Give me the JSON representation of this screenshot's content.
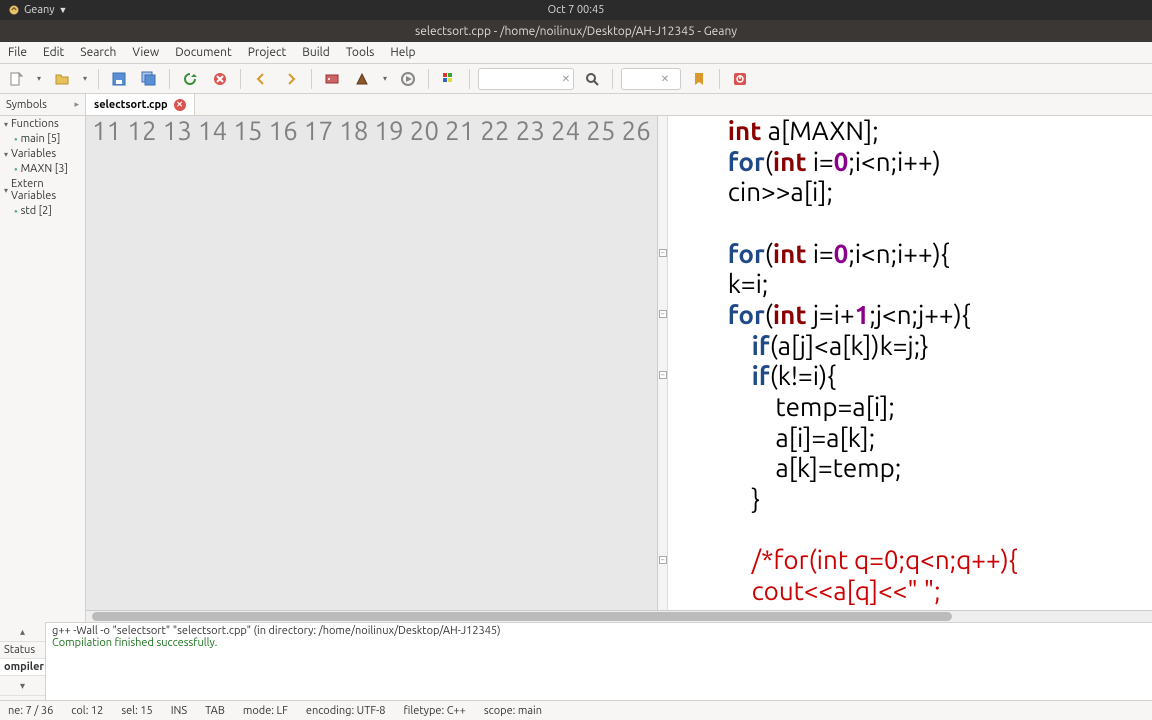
{
  "os": {
    "appname": "Geany",
    "clock": "Oct 7  00:45"
  },
  "title": "selectsort.cpp - /home/noilinux/Desktop/AH-J12345 - Geany",
  "menu": [
    "File",
    "Edit",
    "Search",
    "View",
    "Document",
    "Project",
    "Build",
    "Tools",
    "Help"
  ],
  "sidetab": {
    "label": "Symbols"
  },
  "filetab": {
    "name": "selectsort.cpp"
  },
  "symbols": {
    "groups": [
      {
        "label": "Functions",
        "items": [
          "main [5]"
        ]
      },
      {
        "label": "Variables",
        "items": [
          "MAXN [3]"
        ]
      },
      {
        "label": "Extern Variables",
        "items": [
          "std [2]"
        ]
      }
    ]
  },
  "code": {
    "first_line": 11,
    "lines": [
      {
        "n": 11,
        "tokens": [
          {
            "t": "int ",
            "c": "ty"
          },
          {
            "t": "a[MAXN];"
          }
        ]
      },
      {
        "n": 12,
        "tokens": [
          {
            "t": "for",
            "c": "kw"
          },
          {
            "t": "("
          },
          {
            "t": "int ",
            "c": "ty"
          },
          {
            "t": "i="
          },
          {
            "t": "0",
            "c": "num"
          },
          {
            "t": ";i<n;i++)"
          }
        ]
      },
      {
        "n": 13,
        "tokens": [
          {
            "t": "cin>>a[i];"
          }
        ]
      },
      {
        "n": 14,
        "tokens": [
          {
            "t": ""
          }
        ]
      },
      {
        "n": 15,
        "fold": true,
        "tokens": [
          {
            "t": "for",
            "c": "kw"
          },
          {
            "t": "("
          },
          {
            "t": "int ",
            "c": "ty"
          },
          {
            "t": "i="
          },
          {
            "t": "0",
            "c": "num"
          },
          {
            "t": ";i<n;i++){"
          }
        ]
      },
      {
        "n": 16,
        "tokens": [
          {
            "t": "k=i;"
          }
        ]
      },
      {
        "n": 17,
        "fold": true,
        "tokens": [
          {
            "t": "for",
            "c": "kw"
          },
          {
            "t": "("
          },
          {
            "t": "int ",
            "c": "ty"
          },
          {
            "t": "j=i+"
          },
          {
            "t": "1",
            "c": "num"
          },
          {
            "t": ";j<n;j++){"
          }
        ]
      },
      {
        "n": 18,
        "tokens": [
          {
            "t": "    "
          },
          {
            "t": "if",
            "c": "kw"
          },
          {
            "t": "(a[j]<a[k])k=j;}"
          }
        ]
      },
      {
        "n": 19,
        "fold": true,
        "tokens": [
          {
            "t": "    "
          },
          {
            "t": "if",
            "c": "kw"
          },
          {
            "t": "(k!=i){"
          }
        ]
      },
      {
        "n": 20,
        "tokens": [
          {
            "t": "        temp=a[i];"
          }
        ]
      },
      {
        "n": 21,
        "tokens": [
          {
            "t": "        a[i]=a[k];"
          }
        ]
      },
      {
        "n": 22,
        "tokens": [
          {
            "t": "        a[k]=temp;"
          }
        ]
      },
      {
        "n": 23,
        "tokens": [
          {
            "t": "    }"
          }
        ]
      },
      {
        "n": 24,
        "tokens": [
          {
            "t": ""
          }
        ]
      },
      {
        "n": 25,
        "fold": true,
        "tokens": [
          {
            "t": "    "
          },
          {
            "t": "/*for(int q=0;q<n;q++){",
            "c": "cm"
          }
        ]
      },
      {
        "n": 26,
        "tokens": [
          {
            "t": "    "
          },
          {
            "t": "cout<<a[q]<<\" \";",
            "c": "cm"
          }
        ]
      }
    ]
  },
  "messages": {
    "line1": "g++ -Wall -o \"selectsort\" \"selectsort.cpp\" (in directory: /home/noilinux/Desktop/AH-J12345)",
    "line2": "Compilation finished successfully."
  },
  "bottomtabs": {
    "status": "Status",
    "compiler": "ompiler"
  },
  "status": {
    "pos": "ne: 7 / 36",
    "col": "col: 12",
    "sel": "sel: 15",
    "ins": "INS",
    "tab": "TAB",
    "mode": "mode: LF",
    "enc": "encoding: UTF-8",
    "ftype": "filetype: C++",
    "scope": "scope: main"
  }
}
